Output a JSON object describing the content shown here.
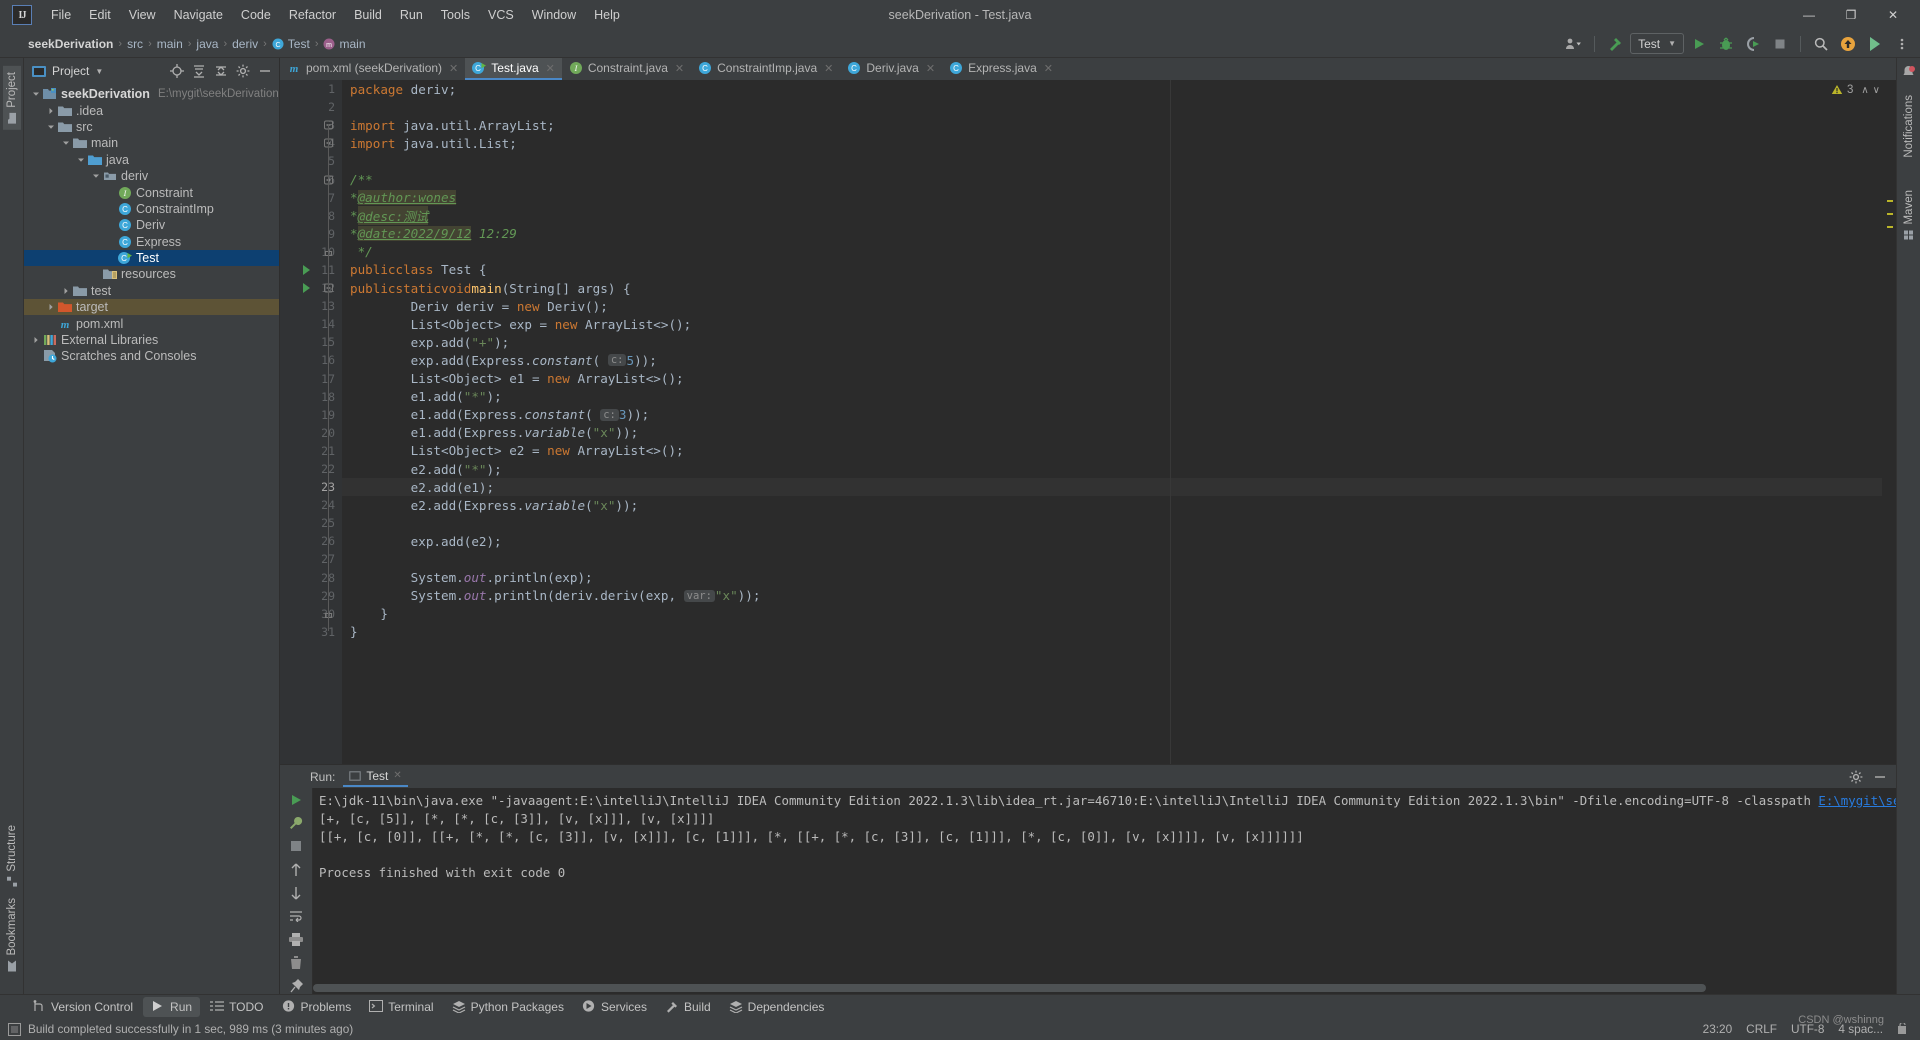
{
  "window": {
    "title": "seekDerivation - Test.java",
    "controls": {
      "minimize": "—",
      "maximize": "❐",
      "close": "✕"
    }
  },
  "menubar": {
    "logo": "IJ",
    "items": [
      "File",
      "Edit",
      "View",
      "Navigate",
      "Code",
      "Refactor",
      "Build",
      "Run",
      "Tools",
      "VCS",
      "Window",
      "Help"
    ]
  },
  "breadcrumb": {
    "items": [
      {
        "label": "seekDerivation",
        "icon": "",
        "bold": true
      },
      {
        "label": "src",
        "icon": ""
      },
      {
        "label": "main",
        "icon": ""
      },
      {
        "label": "java",
        "icon": ""
      },
      {
        "label": "deriv",
        "icon": ""
      },
      {
        "label": "Test",
        "icon": "class-icon"
      },
      {
        "label": "main",
        "icon": "method-icon"
      }
    ],
    "separator": "›"
  },
  "toolbar": {
    "run_config": "Test",
    "config_caret": "▼",
    "icons": [
      "user-dropdown-icon",
      "hammer-build-icon",
      "run-icon",
      "debug-icon",
      "run-coverage-icon",
      "stop-icon",
      "search-everywhere-icon",
      "update-project-icon",
      "ide-feature-icon",
      "more-options-icon"
    ]
  },
  "left_strip": {
    "tabs": [
      {
        "label": "Project",
        "active": true,
        "icon": "project-icon"
      }
    ],
    "bottom_tabs": [
      {
        "label": "Structure",
        "icon": "structure-icon"
      },
      {
        "label": "Bookmarks",
        "icon": "bookmarks-icon"
      }
    ]
  },
  "right_strip": {
    "tabs": [
      {
        "label": "Notifications",
        "icon": "notifications-icon"
      },
      {
        "label": "Maven",
        "icon": "maven-icon"
      }
    ]
  },
  "project_panel": {
    "title": "Project",
    "title_caret": "▼",
    "header_icons": [
      "locate-icon",
      "expand-all-icon",
      "collapse-all-icon",
      "settings-gear-icon",
      "hide-icon"
    ],
    "tree": [
      {
        "depth": 0,
        "label": "seekDerivation",
        "path": "E:\\mygit\\seekDerivation",
        "icon": "module-icon",
        "arrow": "down",
        "bold": true
      },
      {
        "depth": 1,
        "label": ".idea",
        "icon": "folder-icon",
        "arrow": "right"
      },
      {
        "depth": 1,
        "label": "src",
        "icon": "folder-icon",
        "arrow": "down"
      },
      {
        "depth": 2,
        "label": "main",
        "icon": "folder-icon",
        "arrow": "down"
      },
      {
        "depth": 3,
        "label": "java",
        "icon": "source-folder-icon",
        "arrow": "down"
      },
      {
        "depth": 4,
        "label": "deriv",
        "icon": "package-icon",
        "arrow": "down"
      },
      {
        "depth": 5,
        "label": "Constraint",
        "icon": "interface-icon",
        "arrow": "none"
      },
      {
        "depth": 5,
        "label": "ConstraintImp",
        "icon": "class-icon",
        "arrow": "none"
      },
      {
        "depth": 5,
        "label": "Deriv",
        "icon": "class-icon",
        "arrow": "none"
      },
      {
        "depth": 5,
        "label": "Express",
        "icon": "class-icon",
        "arrow": "none"
      },
      {
        "depth": 5,
        "label": "Test",
        "icon": "runnable-class-icon",
        "arrow": "none",
        "selected": true
      },
      {
        "depth": 4,
        "label": "resources",
        "icon": "resource-folder-icon",
        "arrow": "none"
      },
      {
        "depth": 2,
        "label": "test",
        "icon": "folder-icon",
        "arrow": "right"
      },
      {
        "depth": 1,
        "label": "target",
        "icon": "excluded-folder-icon",
        "arrow": "right",
        "highlight": true
      },
      {
        "depth": 1,
        "label": "pom.xml",
        "icon": "maven-file-icon",
        "arrow": "none"
      },
      {
        "depth": 0,
        "label": "External Libraries",
        "icon": "libraries-icon",
        "arrow": "right"
      },
      {
        "depth": 0,
        "label": "Scratches and Consoles",
        "icon": "scratches-icon",
        "arrow": "none"
      }
    ]
  },
  "editor_tabs": [
    {
      "label": "pom.xml (seekDerivation)",
      "icon": "maven-file-icon",
      "active": false,
      "close": "✕"
    },
    {
      "label": "Test.java",
      "icon": "runnable-class-icon",
      "active": true,
      "close": "✕"
    },
    {
      "label": "Constraint.java",
      "icon": "interface-icon",
      "active": false,
      "close": "✕"
    },
    {
      "label": "ConstraintImp.java",
      "icon": "class-icon",
      "active": false,
      "close": "✕"
    },
    {
      "label": "Deriv.java",
      "icon": "class-icon",
      "active": false,
      "close": "✕"
    },
    {
      "label": "Express.java",
      "icon": "class-icon",
      "active": false,
      "close": "✕"
    }
  ],
  "editor": {
    "warning_count": "3",
    "warning_icon": "warning-triangle-icon",
    "nav_up": "∧",
    "nav_down": "∨",
    "lines": [
      {
        "n": 1,
        "raw": "package deriv;"
      },
      {
        "n": 2,
        "raw": ""
      },
      {
        "n": 3,
        "raw": "import java.util.ArrayList;",
        "fold": "minus"
      },
      {
        "n": 4,
        "raw": "import java.util.List;",
        "fold": "minus"
      },
      {
        "n": 5,
        "raw": ""
      },
      {
        "n": 6,
        "raw": "/**",
        "fold": "minus"
      },
      {
        "n": 7,
        "raw": " * @author:wones"
      },
      {
        "n": 8,
        "raw": " * @desc:测试"
      },
      {
        "n": 9,
        "raw": " * @date:2022/9/12 12:29"
      },
      {
        "n": 10,
        "raw": " */",
        "fold": "end"
      },
      {
        "n": 11,
        "raw": "public class Test {",
        "run": true
      },
      {
        "n": 12,
        "raw": "    public static void main(String[] args) {",
        "run": true,
        "fold": "minus"
      },
      {
        "n": 13,
        "raw": "        Deriv deriv = new Deriv();"
      },
      {
        "n": 14,
        "raw": "        List<Object> exp = new ArrayList<>();"
      },
      {
        "n": 15,
        "raw": "        exp.add(\"+\");"
      },
      {
        "n": 16,
        "raw": "        exp.add(Express.constant( c: 5));"
      },
      {
        "n": 17,
        "raw": "        List<Object> e1 = new ArrayList<>();"
      },
      {
        "n": 18,
        "raw": "        e1.add(\"*\");"
      },
      {
        "n": 19,
        "raw": "        e1.add(Express.constant( c: 3));"
      },
      {
        "n": 20,
        "raw": "        e1.add(Express.variable(\"x\"));"
      },
      {
        "n": 21,
        "raw": "        List<Object> e2 = new ArrayList<>();"
      },
      {
        "n": 22,
        "raw": "        e2.add(\"*\");"
      },
      {
        "n": 23,
        "raw": "        e2.add(e1);",
        "current": true
      },
      {
        "n": 24,
        "raw": "        e2.add(Express.variable(\"x\"));"
      },
      {
        "n": 25,
        "raw": ""
      },
      {
        "n": 26,
        "raw": "        exp.add(e2);"
      },
      {
        "n": 27,
        "raw": ""
      },
      {
        "n": 28,
        "raw": "        System.out.println(exp);"
      },
      {
        "n": 29,
        "raw": "        System.out.println(deriv.deriv(exp, var: \"x\"));"
      },
      {
        "n": 30,
        "raw": "    }",
        "fold": "end"
      },
      {
        "n": 31,
        "raw": "}"
      }
    ]
  },
  "run_panel": {
    "label": "Run:",
    "tab": "Test",
    "tab_icon": "run-config-icon",
    "tab_close": "✕",
    "side_icons": [
      "rerun-icon",
      "debug-wrench-icon",
      "stop-icon",
      "scroll-up-icon",
      "scroll-down-icon",
      "soft-wrap-icon",
      "print-icon",
      "clear-all-icon",
      "pin-icon"
    ],
    "header_icons": [
      "settings-gear-icon",
      "hide-icon"
    ],
    "console_lines": [
      {
        "text": "E:\\jdk-11\\bin\\java.exe \"-javaagent:E:\\intelliJ\\IntelliJ IDEA Community Edition 2022.1.3\\lib\\idea_rt.jar=46710:E:\\intelliJ\\IntelliJ IDEA Community Edition 2022.1.3\\bin\" -Dfile.encoding=UTF-8 -classpath ",
        "link": "E:\\mygit\\seekDerivation\\t"
      },
      {
        "text": "[+, [c, [5]], [*, [*, [c, [3]], [v, [x]]], [v, [x]]]]"
      },
      {
        "text": "[[+, [c, [0]], [[+, [*, [*, [c, [3]], [v, [x]]], [c, [1]]], [*, [[+, [*, [c, [3]], [c, [1]]], [*, [c, [0]], [v, [x]]]], [v, [x]]]]]]"
      },
      {
        "text": ""
      },
      {
        "text": "Process finished with exit code 0"
      }
    ]
  },
  "bottom_toolbar": {
    "tabs": [
      {
        "label": "Version Control",
        "icon": "vcs-branch-icon"
      },
      {
        "label": "Run",
        "icon": "run-icon",
        "active": true
      },
      {
        "label": "TODO",
        "icon": "todo-icon"
      },
      {
        "label": "Problems",
        "icon": "problems-icon"
      },
      {
        "label": "Terminal",
        "icon": "terminal-icon"
      },
      {
        "label": "Python Packages",
        "icon": "python-packages-icon"
      },
      {
        "label": "Services",
        "icon": "services-icon"
      },
      {
        "label": "Build",
        "icon": "build-hammer-icon"
      },
      {
        "label": "Dependencies",
        "icon": "dependencies-icon"
      }
    ]
  },
  "statusbar": {
    "message_icon": "build-status-icon",
    "message": "Build completed successfully in 1 sec, 989 ms (3 minutes ago)",
    "caret": "23:20",
    "line_separator": "CRLF",
    "encoding": "UTF-8",
    "indent": "4 spac...",
    "lock_icon": "read-only-icon",
    "watermark": "CSDN @wshinng"
  },
  "colors": {
    "accent": "#4a88c7",
    "selection": "#0d4071",
    "editor_bg": "#2b2b2b",
    "panel_bg": "#3c3f41",
    "gutter_bg": "#313335",
    "keyword": "#cc7832",
    "string": "#6a8759",
    "number": "#6897bb",
    "comment": "#629755",
    "field": "#9876aa",
    "method": "#ffc66d",
    "warning": "#bbb529",
    "highlight_row": "#5d5336"
  }
}
